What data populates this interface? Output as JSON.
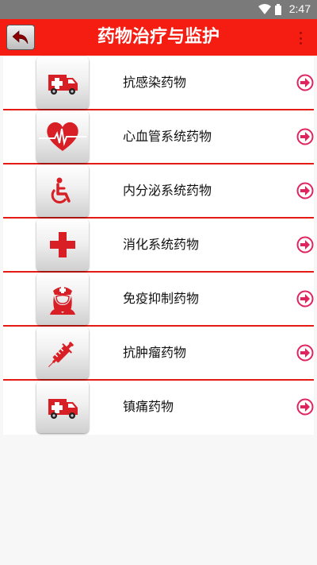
{
  "status_bar": {
    "time": "2:47"
  },
  "app_bar": {
    "title": "药物治疗与监护"
  },
  "items": [
    {
      "label": "抗感染药物",
      "icon": "ambulance-icon"
    },
    {
      "label": "心血管系统药物",
      "icon": "heart-pulse-icon"
    },
    {
      "label": "内分泌系统药物",
      "icon": "wheelchair-icon"
    },
    {
      "label": "消化系统药物",
      "icon": "medical-cross-icon"
    },
    {
      "label": "免疫抑制药物",
      "icon": "nurse-icon"
    },
    {
      "label": "抗肿瘤药物",
      "icon": "syringe-icon"
    },
    {
      "label": "镇痛药物",
      "icon": "ambulance-icon"
    }
  ],
  "colors": {
    "accent": "#f51c12",
    "icon_red": "#d81f26",
    "arrow": "#e0245e"
  }
}
